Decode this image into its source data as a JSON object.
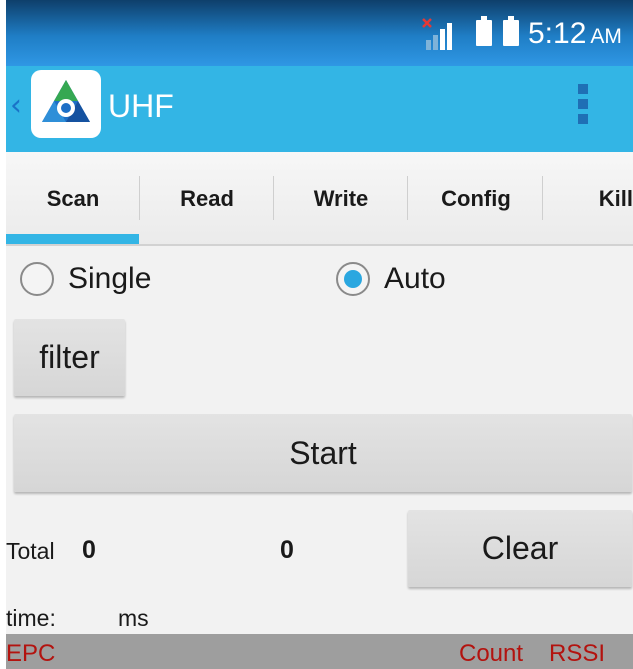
{
  "status_bar": {
    "time": "5:12",
    "ampm": "AM",
    "icons": [
      "no-sim-signal-icon",
      "battery-icon",
      "battery-icon"
    ]
  },
  "action_bar": {
    "title": "UHF",
    "icons": [
      "back-chevron-icon",
      "app-logo-icon",
      "overflow-menu-icon"
    ]
  },
  "tabs": [
    {
      "label": "Scan",
      "selected": true
    },
    {
      "label": "Read",
      "selected": false
    },
    {
      "label": "Write",
      "selected": false
    },
    {
      "label": "Config",
      "selected": false
    },
    {
      "label": "Kill",
      "selected": false
    }
  ],
  "mode": {
    "single_label": "Single",
    "auto_label": "Auto",
    "selected": "Auto"
  },
  "buttons": {
    "filter_label": "filter",
    "start_label": "Start",
    "clear_label": "Clear"
  },
  "stats": {
    "total_label": "Total",
    "total_value": "0",
    "count_value": "0",
    "time_label": "time:",
    "time_unit": "ms"
  },
  "list_header": {
    "epc": "EPC",
    "count": "Count",
    "rssi": "RSSI"
  },
  "colors": {
    "action_bar": "#33b5e5",
    "tab_indicator": "#33b5e5",
    "radio_selected": "#2aa7e0",
    "list_header_bg": "#9e9e9e",
    "list_header_text": "#b3130f"
  }
}
